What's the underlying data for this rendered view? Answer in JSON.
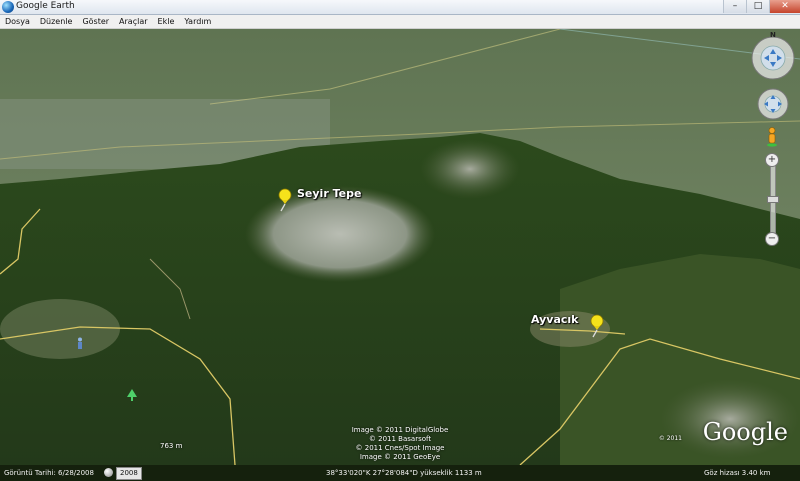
{
  "window": {
    "title": "Google Earth",
    "minimize_glyph": "–",
    "maximize_glyph": "□",
    "close_glyph": "✕"
  },
  "menu": {
    "items": [
      "Dosya",
      "Düzenle",
      "Göster",
      "Araçlar",
      "Ekle",
      "Yardım"
    ]
  },
  "map": {
    "placemarks": [
      {
        "label": "Seyir Tepe",
        "icon": "yellow-pushpin-icon"
      },
      {
        "label": "Ayvacık",
        "icon": "yellow-pushpin-icon"
      }
    ],
    "elevation_label": "763 m",
    "credits": [
      "Image © 2011 DigitalGlobe",
      "© 2011 Basarsoft",
      "© 2011 Cnes/Spot Image",
      "Image © 2011 GeoEye"
    ],
    "logo_text": "Google",
    "logo_copyright": "© 2011"
  },
  "navigation": {
    "north_label": "N",
    "zoom_in_glyph": "+",
    "zoom_out_glyph": "−"
  },
  "statusbar": {
    "imagery_date": "Görüntü Tarihi: 6/28/2008",
    "year": "2008",
    "coordinates": "38°33'020\"K   27°28'084\"D yükseklik 1133 m",
    "eye_alt": "Göz hizası    3.40 km"
  },
  "colors": {
    "forest": "#2f4a1e",
    "pin": "#f5e21b",
    "road": "#d8c664"
  }
}
